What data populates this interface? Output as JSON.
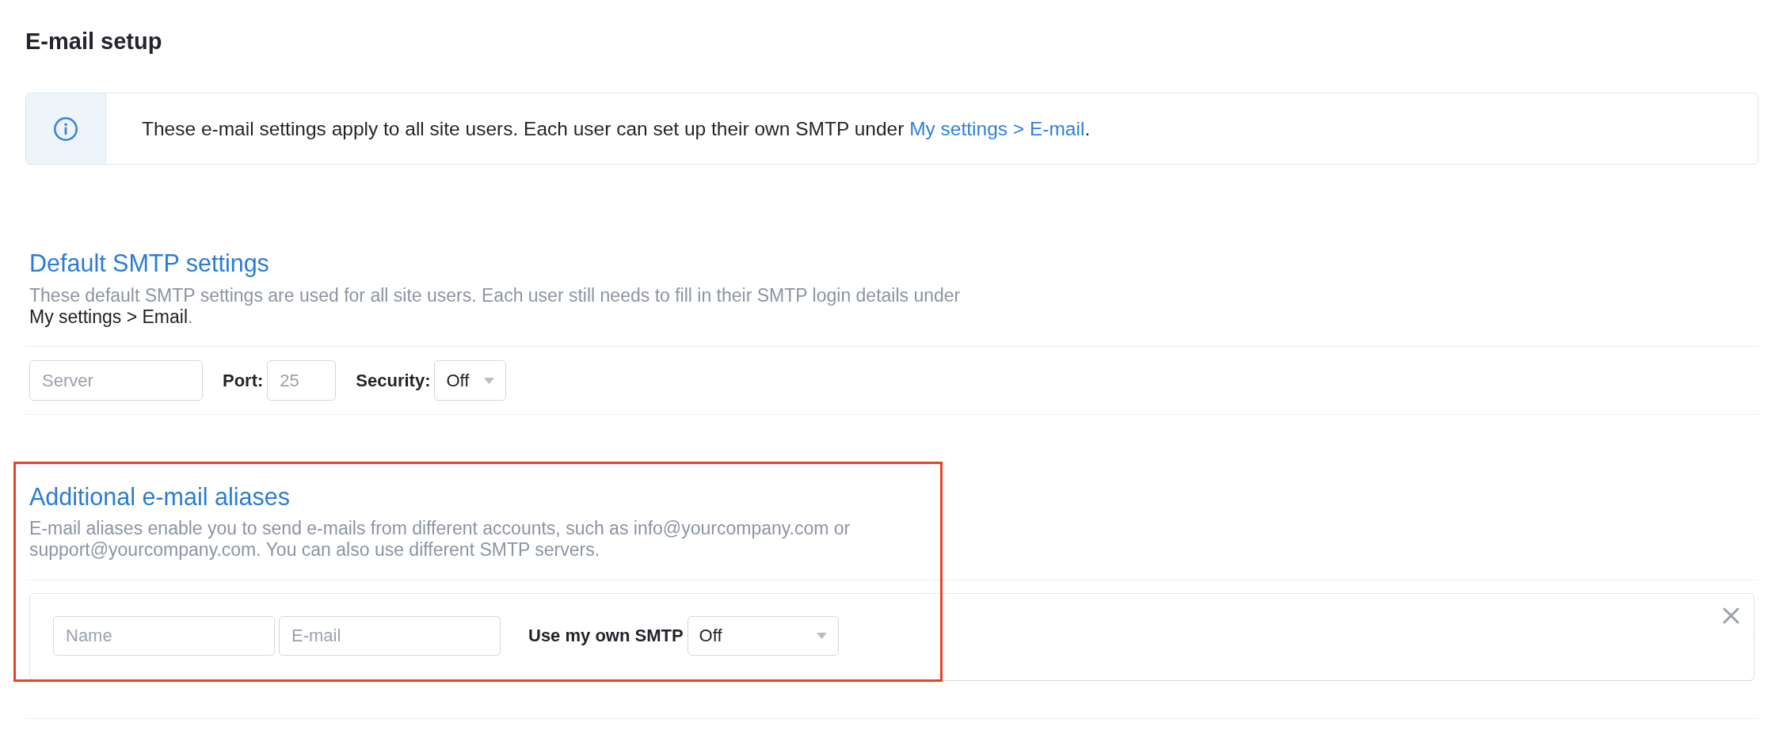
{
  "page": {
    "title": "E-mail setup"
  },
  "notice": {
    "text": "These e-mail settings apply to all site users. Each user can set up their own SMTP under ",
    "link": "My settings > E-mail",
    "text_end": "."
  },
  "default_smtp": {
    "heading": "Default SMTP settings",
    "description": "These default SMTP settings are used for all site users. Each user still needs to fill in their SMTP login details under ",
    "link": "My settings > Email",
    "description_end": ".",
    "fields": [
      {
        "kind": "input",
        "placeholder": "Server"
      },
      {
        "kind": "input",
        "label": "Port:",
        "placeholder": "25"
      },
      {
        "kind": "select",
        "label": "Security:",
        "value": "Off"
      }
    ]
  },
  "aliases": {
    "heading": "Additional e-mail aliases",
    "description": "E-mail aliases enable you to send e-mails from different accounts, such as info@yourcompany.com or support@yourcompany.com. You can also use different SMTP servers.",
    "highlighted": true,
    "rows": [
      {
        "fields": [
          {
            "kind": "input",
            "placeholder": "Name"
          },
          {
            "kind": "input",
            "placeholder": "E-mail"
          },
          {
            "kind": "select",
            "label": "Use my own SMTP",
            "value": "Off"
          }
        ]
      }
    ]
  }
}
